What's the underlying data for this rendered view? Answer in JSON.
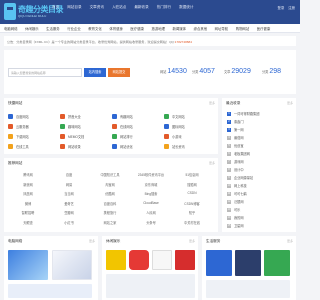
{
  "header": {
    "logo_text": "奇趣分类目录",
    "logo_sub": "QIQU FENLEI MULU",
    "nav": [
      "首页",
      "网站目录",
      "文章资讯",
      "入驻站点",
      "最新收录",
      "热门排行",
      "数据统计"
    ],
    "right": [
      "登录",
      "注册"
    ]
  },
  "categories": [
    "电脑网络",
    "休闲娱乐",
    "生活服务",
    "行业企业",
    "教育文化",
    "体育健身",
    "医疗健康",
    "旅游地理",
    "新闻媒体",
    "综合其他",
    "网址导航",
    "购物网站",
    "医疗健康"
  ],
  "notice": {
    "prefix": "公告：分类目录网（FXML.CC）是一个专业的网站分类目录平台，收录优秀网站，提供网站收录服务，欢迎提交网站！QQ:",
    "contact": "1782748884"
  },
  "search": {
    "placeholder": "请输入您要搜索的网站名称",
    "search_label": "站内搜索",
    "submit_label": "网站提交"
  },
  "stats": [
    {
      "label": "网站",
      "value": "14530"
    },
    {
      "label": "分类",
      "value": "4057"
    },
    {
      "label": "文章",
      "value": "29029"
    },
    {
      "label": "分类",
      "value": "298"
    }
  ],
  "quick": {
    "title": "快捷网站",
    "more": "更多",
    "items": [
      {
        "name": "百度网站",
        "color": "#2d67d3"
      },
      {
        "name": "拼音大全",
        "color": "#e25a2a"
      },
      {
        "name": "有趣网站",
        "color": "#2d67d3"
      },
      {
        "name": "中文网站",
        "color": "#36a852"
      },
      {
        "name": "云服务器",
        "color": "#e25a2a"
      },
      {
        "name": "趣味网站",
        "color": "#36a852"
      },
      {
        "name": "在线网站",
        "color": "#e25a2a"
      },
      {
        "name": "图标网站",
        "color": "#2d67d3"
      },
      {
        "name": "下载网站",
        "color": "#f2a21d"
      },
      {
        "name": "MEMO文档",
        "color": "#e25a2a"
      },
      {
        "name": "网站排行",
        "color": "#36a852"
      },
      {
        "name": "小游戏",
        "color": "#e25a2a"
      },
      {
        "name": "在线工具",
        "color": "#f2a21d"
      },
      {
        "name": "网站收录",
        "color": "#e25a2a"
      },
      {
        "name": "网站优化",
        "color": "#2d67d3"
      },
      {
        "name": "站长资讯",
        "color": "#f2a21d"
      }
    ]
  },
  "recommend": {
    "title": "推荐网站",
    "more": "更多",
    "items": [
      "腾讯网",
      "百度",
      "中国知识工具",
      "2345软件资讯平台",
      "51信息网",
      "新浪网",
      "网易",
      "淘宝网",
      "京东商城",
      "搜狐网",
      "凤凰网",
      "当当网",
      "优酷网",
      "Bing搜索",
      "CSDN",
      "微博",
      "爱奇艺",
      "百度百科",
      "CloudBase",
      "CSDN博客",
      "智联招聘",
      "豆瓣网",
      "携程旅行",
      "人民网",
      "知乎",
      "天眼查",
      "小红书",
      "网站之家",
      "头条号",
      "中关村在线"
    ]
  },
  "latest": {
    "title": "最近收录",
    "more": "更多",
    "items": [
      "一词可得财路集团",
      "泰鑫门",
      "第一网",
      "番茄网",
      "优创宝",
      "老板集团网",
      "游戏网",
      "设计中",
      "企业网源量站",
      "网上科技",
      "可可七鹤",
      "泛银网",
      "可乐",
      "我的网",
      "卫星网"
    ]
  },
  "bottom": [
    {
      "title": "电脑网络",
      "more": "更多"
    },
    {
      "title": "休闲娱乐",
      "more": "更多"
    },
    {
      "title": "生活服务",
      "more": "更多"
    }
  ]
}
